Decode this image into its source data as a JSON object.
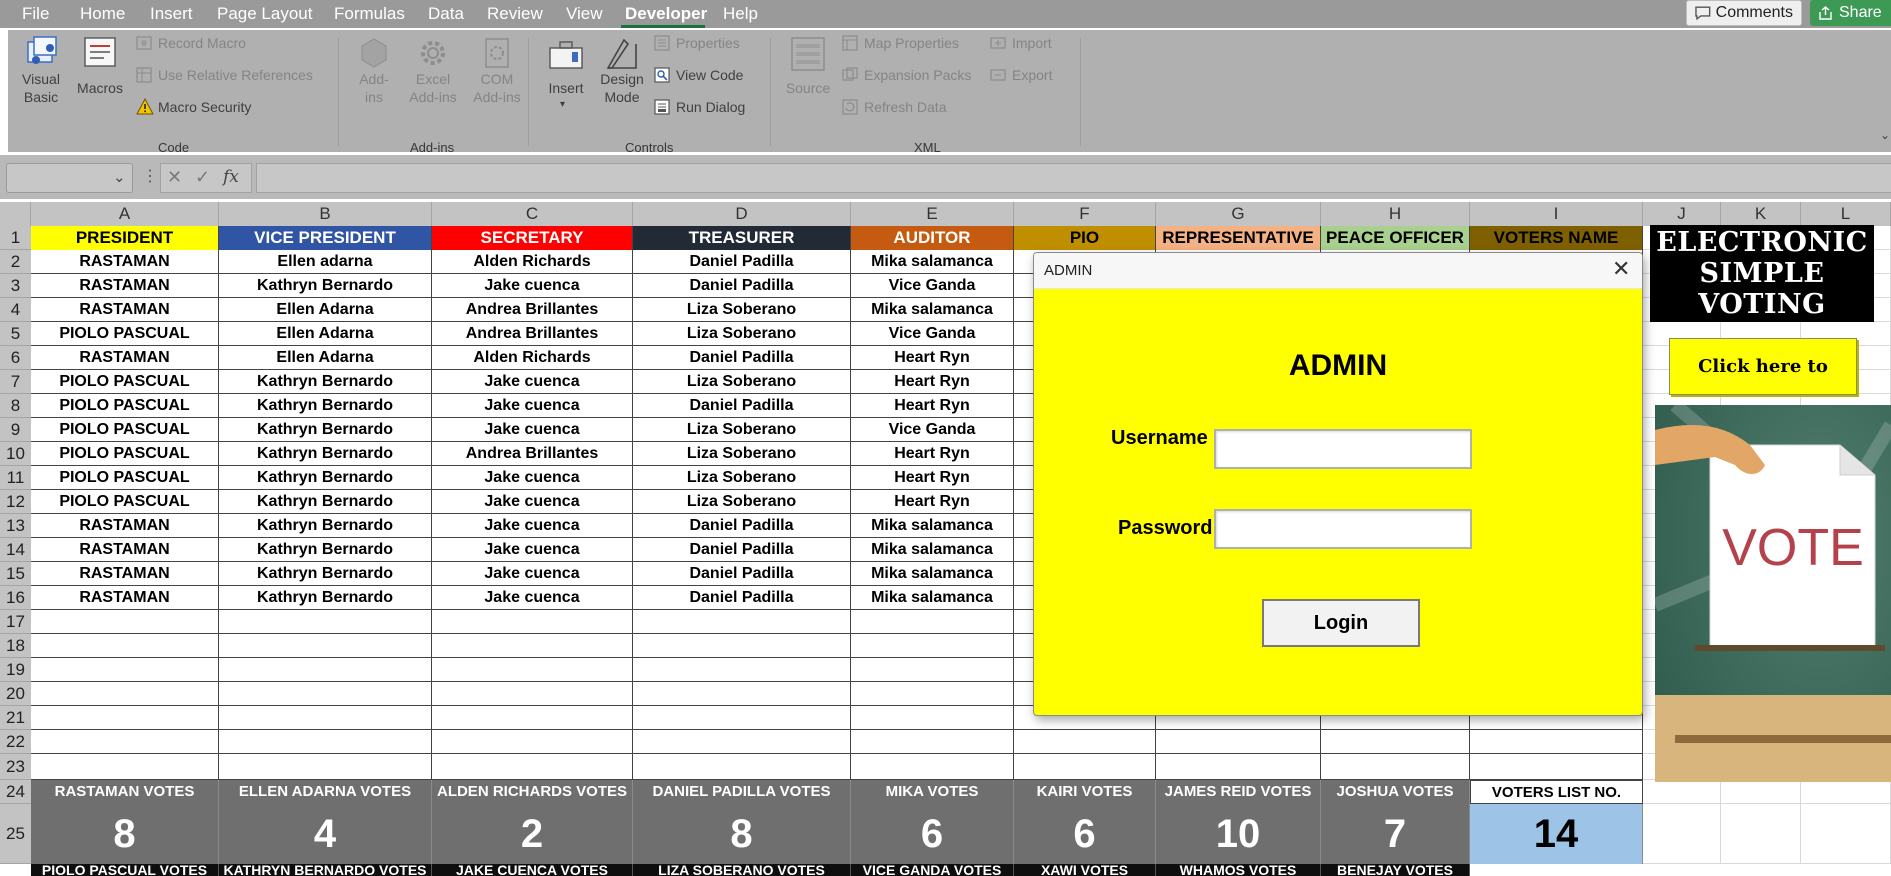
{
  "menu": {
    "items": [
      "File",
      "Home",
      "Insert",
      "Page Layout",
      "Formulas",
      "Data",
      "Review",
      "View",
      "Developer",
      "Help"
    ],
    "active": "Developer",
    "comments_label": "Comments",
    "share_label": "Share"
  },
  "ribbon": {
    "code": {
      "visual_basic": [
        "Visual",
        "Basic"
      ],
      "macros": "Macros",
      "record_macro": "Record Macro",
      "use_relative": "Use Relative References",
      "macro_security": "Macro Security",
      "group": "Code"
    },
    "addins": {
      "addins": [
        "Add-",
        "ins"
      ],
      "excel_addins": [
        "Excel",
        "Add-ins"
      ],
      "com_addins": [
        "COM",
        "Add-ins"
      ],
      "group": "Add-ins"
    },
    "controls": {
      "insert": "Insert",
      "design_mode": [
        "Design",
        "Mode"
      ],
      "properties": "Properties",
      "view_code": "View Code",
      "run_dialog": "Run Dialog",
      "group": "Controls"
    },
    "xml": {
      "source": "Source",
      "map_properties": "Map Properties",
      "expansion_packs": "Expansion Packs",
      "refresh_data": "Refresh Data",
      "import": "Import",
      "export": "Export",
      "group": "XML"
    }
  },
  "formula_bar": {
    "fx": "fx",
    "value": ""
  },
  "columns": [
    "A",
    "B",
    "C",
    "D",
    "E",
    "F",
    "G",
    "H",
    "I",
    "J",
    "K",
    "L"
  ],
  "rows": [
    "1",
    "2",
    "3",
    "4",
    "5",
    "6",
    "7",
    "8",
    "9",
    "10",
    "11",
    "12",
    "13",
    "14",
    "15",
    "16",
    "17",
    "18",
    "19",
    "20",
    "21",
    "22",
    "23",
    "24",
    "25"
  ],
  "headers": [
    "PRESIDENT",
    "VICE PRESIDENT",
    "SECRETARY",
    "TREASURER",
    "AUDITOR",
    "PIO",
    "REPRESENTATIVE",
    "PEACE OFFICER",
    "VOTERS NAME"
  ],
  "header_colors": [
    "#ffff00",
    "#2f55a4",
    "#ff0000",
    "#222a35",
    "#c55a11",
    "#bf8f00",
    "#f4b183",
    "#a9d08e",
    "#7f6000"
  ],
  "ballots": [
    [
      "RASTAMAN",
      "Ellen adarna",
      "Alden Richards",
      "Daniel Padilla",
      "Mika salamanca"
    ],
    [
      "RASTAMAN",
      "Kathryn Bernardo",
      "Jake cuenca",
      "Daniel Padilla",
      "Vice Ganda"
    ],
    [
      "RASTAMAN",
      "Ellen Adarna",
      "Andrea Brillantes",
      "Liza Soberano",
      "Mika salamanca"
    ],
    [
      "PIOLO PASCUAL",
      "Ellen Adarna",
      "Andrea Brillantes",
      "Liza Soberano",
      "Vice Ganda"
    ],
    [
      "RASTAMAN",
      "Ellen Adarna",
      "Alden Richards",
      "Daniel Padilla",
      "Heart Ryn"
    ],
    [
      "PIOLO PASCUAL",
      "Kathryn Bernardo",
      "Jake cuenca",
      "Liza Soberano",
      "Heart Ryn"
    ],
    [
      "PIOLO PASCUAL",
      "Kathryn Bernardo",
      "Jake cuenca",
      "Daniel Padilla",
      "Heart Ryn"
    ],
    [
      "PIOLO PASCUAL",
      "Kathryn Bernardo",
      "Jake cuenca",
      "Liza Soberano",
      "Vice Ganda"
    ],
    [
      "PIOLO PASCUAL",
      "Kathryn Bernardo",
      "Andrea Brillantes",
      "Liza Soberano",
      "Heart Ryn"
    ],
    [
      "PIOLO PASCUAL",
      "Kathryn Bernardo",
      "Jake cuenca",
      "Liza Soberano",
      "Heart Ryn"
    ],
    [
      "PIOLO PASCUAL",
      "Kathryn Bernardo",
      "Jake cuenca",
      "Liza Soberano",
      "Heart Ryn"
    ],
    [
      "RASTAMAN",
      "Kathryn Bernardo",
      "Jake cuenca",
      "Daniel Padilla",
      "Mika salamanca"
    ],
    [
      "RASTAMAN",
      "Kathryn Bernardo",
      "Jake cuenca",
      "Daniel Padilla",
      "Mika salamanca"
    ],
    [
      "RASTAMAN",
      "Kathryn Bernardo",
      "Jake cuenca",
      "Daniel Padilla",
      "Mika salamanca"
    ],
    [
      "RASTAMAN",
      "Kathryn Bernardo",
      "Jake cuenca",
      "Daniel Padilla",
      "Mika salamanca"
    ]
  ],
  "vote_labels": [
    "RASTAMAN VOTES",
    "ELLEN ADARNA VOTES",
    "ALDEN RICHARDS VOTES",
    "DANIEL PADILLA VOTES",
    "MIKA VOTES",
    "KAIRI VOTES",
    "JAMES REID VOTES",
    "JOSHUA VOTES",
    "VOTERS LIST  NO."
  ],
  "vote_counts": [
    "8",
    "4",
    "2",
    "8",
    "6",
    "6",
    "10",
    "7",
    "14"
  ],
  "vote_labels_row26": [
    "PIOLO PASCUAL VOTES",
    "KATHRYN BERNARDO VOTES",
    "JAKE CUENCA VOTES",
    "LIZA SOBERANO  VOTES",
    "VICE GANDA VOTES",
    "XAWI VOTES",
    "WHAMOS VOTES",
    "BENEJAY VOTES"
  ],
  "dialog": {
    "title": "ADMIN",
    "close": "✕",
    "heading": "ADMIN",
    "username_label": "Username",
    "password_label": "Password",
    "username_value": "",
    "password_value": "",
    "login_label": "Login"
  },
  "panel": {
    "title_lines": [
      "ELECTRONIC",
      "SIMPLE",
      "VOTING"
    ],
    "vote_button": "Click here to Vote!",
    "vote_image_text": "VOTE"
  },
  "colors": {
    "accent": "#1f6e43",
    "dialog_bg": "#ffff00",
    "tally_bg": "#6f6f6f",
    "voters_no_bg": "#9dc3e6"
  }
}
